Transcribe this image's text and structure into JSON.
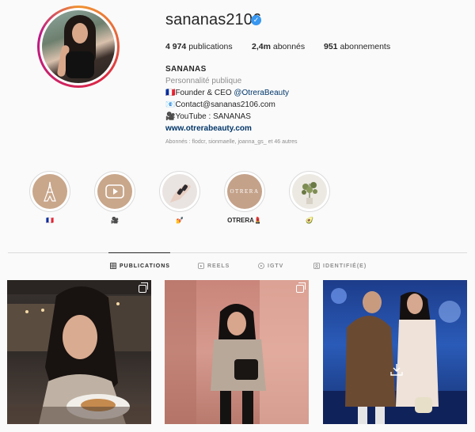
{
  "profile": {
    "username": "sananas2106",
    "verified_mark": "✓",
    "stats": {
      "posts_value": "4 974",
      "posts_label": " publications",
      "followers_value": "2,4m",
      "followers_label": " abonnés",
      "following_value": "951",
      "following_label": " abonnements"
    },
    "bio": {
      "name": "SANANAS",
      "category": "Personnalité publique",
      "line1_prefix": "🇫🇷Founder & CEO ",
      "line1_mention": "@OtreraBeauty",
      "line2": "📧Contact@sananas2106.com",
      "line3": "🎥YouTube : SANANAS",
      "website": "www.otrerabeauty.com"
    },
    "followed_by": "Abonnés : flodcr, sionmaelle, joanna_gs_ et 46 autres"
  },
  "highlights": [
    {
      "label": "🇫🇷",
      "icon": "eiffel-tower-icon"
    },
    {
      "label": "🎥",
      "icon": "youtube-icon"
    },
    {
      "label": "💅",
      "icon": "nails-icon"
    },
    {
      "label": "OTRERA💄",
      "icon": "otrera-logo",
      "logo_text": "OTRERA"
    },
    {
      "label": "🥑",
      "icon": "plant-icon"
    }
  ],
  "tabs": [
    {
      "label": "PUBLICATIONS",
      "icon": "grid-icon",
      "active": true
    },
    {
      "label": "REELS",
      "icon": "reels-icon",
      "active": false
    },
    {
      "label": "IGTV",
      "icon": "igtv-icon",
      "active": false
    },
    {
      "label": "IDENTIFIÉ(E)",
      "icon": "tagged-icon",
      "active": false
    }
  ],
  "colors": {
    "verified": "#3897f0",
    "link": "#003569",
    "highlight_bg": "#c9a78b"
  }
}
